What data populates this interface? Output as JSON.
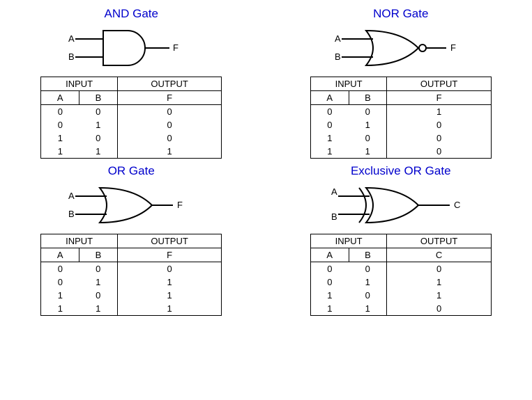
{
  "gates": [
    {
      "title": "AND Gate",
      "inputs": [
        "A",
        "B"
      ],
      "output_label": "F",
      "headers": {
        "input": "INPUT",
        "output": "OUTPUT",
        "a": "A",
        "b": "B",
        "f": "F"
      },
      "rows": [
        {
          "a": "0",
          "b": "0",
          "f": "0"
        },
        {
          "a": "0",
          "b": "1",
          "f": "0"
        },
        {
          "a": "1",
          "b": "0",
          "f": "0"
        },
        {
          "a": "1",
          "b": "1",
          "f": "1"
        }
      ]
    },
    {
      "title": "NOR Gate",
      "inputs": [
        "A",
        "B"
      ],
      "output_label": "F",
      "headers": {
        "input": "INPUT",
        "output": "OUTPUT",
        "a": "A",
        "b": "B",
        "f": "F"
      },
      "rows": [
        {
          "a": "0",
          "b": "0",
          "f": "1"
        },
        {
          "a": "0",
          "b": "1",
          "f": "0"
        },
        {
          "a": "1",
          "b": "0",
          "f": "0"
        },
        {
          "a": "1",
          "b": "1",
          "f": "0"
        }
      ]
    },
    {
      "title": "OR Gate",
      "inputs": [
        "A",
        "B"
      ],
      "output_label": "F",
      "headers": {
        "input": "INPUT",
        "output": "OUTPUT",
        "a": "A",
        "b": "B",
        "f": "F"
      },
      "rows": [
        {
          "a": "0",
          "b": "0",
          "f": "0"
        },
        {
          "a": "0",
          "b": "1",
          "f": "1"
        },
        {
          "a": "1",
          "b": "0",
          "f": "1"
        },
        {
          "a": "1",
          "b": "1",
          "f": "1"
        }
      ]
    },
    {
      "title": "Exclusive OR Gate",
      "inputs": [
        "A",
        "B"
      ],
      "output_label": "C",
      "headers": {
        "input": "INPUT",
        "output": "OUTPUT",
        "a": "A",
        "b": "B",
        "f": "C"
      },
      "rows": [
        {
          "a": "0",
          "b": "0",
          "f": "0"
        },
        {
          "a": "0",
          "b": "1",
          "f": "1"
        },
        {
          "a": "1",
          "b": "0",
          "f": "1"
        },
        {
          "a": "1",
          "b": "1",
          "f": "0"
        }
      ]
    }
  ]
}
